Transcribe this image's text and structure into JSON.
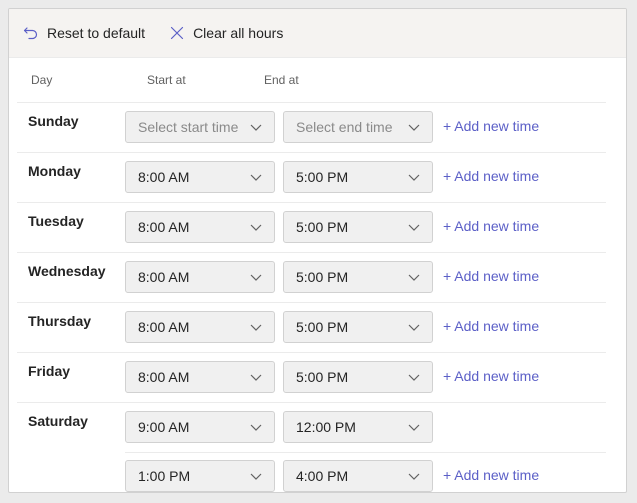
{
  "toolbar": {
    "reset_label": "Reset to default",
    "clear_label": "Clear all hours"
  },
  "headers": {
    "day": "Day",
    "start": "Start at",
    "end": "End at"
  },
  "add_time_label": "+ Add new time",
  "days": [
    {
      "name": "Sunday",
      "slots": [
        {
          "start": "Select start time",
          "end": "Select end time",
          "placeholder": true,
          "add": true
        }
      ]
    },
    {
      "name": "Monday",
      "slots": [
        {
          "start": "8:00 AM",
          "end": "5:00 PM",
          "add": true
        }
      ]
    },
    {
      "name": "Tuesday",
      "slots": [
        {
          "start": "8:00 AM",
          "end": "5:00 PM",
          "add": true
        }
      ]
    },
    {
      "name": "Wednesday",
      "slots": [
        {
          "start": "8:00 AM",
          "end": "5:00 PM",
          "add": true
        }
      ]
    },
    {
      "name": "Thursday",
      "slots": [
        {
          "start": "8:00 AM",
          "end": "5:00 PM",
          "add": true
        }
      ]
    },
    {
      "name": "Friday",
      "slots": [
        {
          "start": "8:00 AM",
          "end": "5:00 PM",
          "add": true
        }
      ]
    },
    {
      "name": "Saturday",
      "slots": [
        {
          "start": "9:00 AM",
          "end": "12:00 PM",
          "add": false
        },
        {
          "start": "1:00 PM",
          "end": "4:00 PM",
          "add": true
        }
      ]
    }
  ],
  "colors": {
    "accent": "#5b5fc7",
    "toolbar_bg": "#f5f3f1",
    "select_bg": "#f0f0f0"
  }
}
